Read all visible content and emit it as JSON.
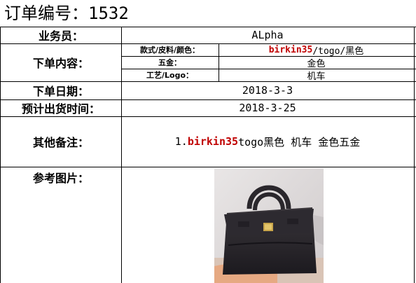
{
  "header": {
    "title": "订单编号：1532"
  },
  "rows": {
    "salesperson": {
      "label": "业务员：",
      "value": "ALpha"
    },
    "order_content": {
      "label": "下单内容：",
      "style": {
        "label": "款式/皮料/颜色：",
        "value_red": "birkin35",
        "value_rest": "/togo/黑色"
      },
      "hardware": {
        "label": "五金：",
        "value": "金色"
      },
      "craft": {
        "label": "工艺/Logo：",
        "value": "机车"
      }
    },
    "order_date": {
      "label": "下单日期：",
      "value": "2018-3-3"
    },
    "ship_date": {
      "label": "预计出货时间：",
      "value": "2018-3-25"
    },
    "remarks": {
      "label": "其他备注：",
      "prefix": "1.",
      "value_red": "birkin35",
      "value_rest": " togo黑色 机车 金色五金"
    },
    "reference": {
      "label": "参考图片："
    }
  },
  "colors": {
    "highlight": "#c00000",
    "border": "#000000"
  }
}
